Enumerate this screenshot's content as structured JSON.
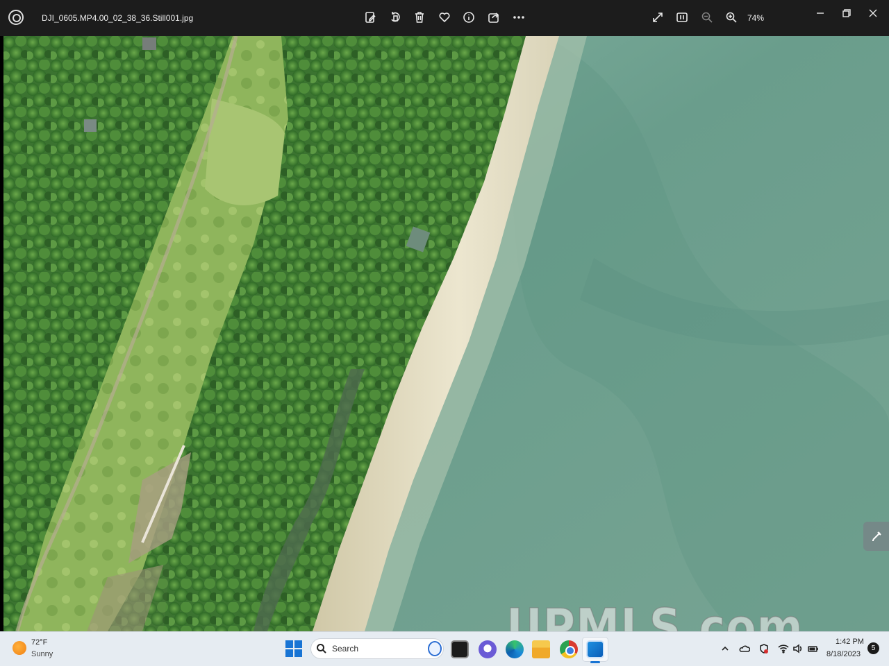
{
  "titlebar": {
    "file_name": "DJI_0605.MP4.00_02_38_36.Still001.jpg",
    "zoom_level": "74%",
    "toolbar_icons": [
      "edit-image-icon",
      "rotate-icon",
      "delete-icon",
      "favorite-icon",
      "info-icon",
      "share-icon",
      "more-icon"
    ],
    "view_icons": [
      "fullscreen-icon",
      "fit-window-icon",
      "zoom-out-icon",
      "zoom-in-icon"
    ],
    "window_controls": [
      "minimize-icon",
      "restore-icon",
      "close-icon"
    ]
  },
  "photo": {
    "description_label": "",
    "watermark": "UPMLS.com"
  },
  "taskbar": {
    "weather": {
      "temperature": "72°F",
      "condition": "Sunny"
    },
    "search_label": "Search",
    "apps": [
      "start-icon",
      "terminal-icon",
      "chat-icon",
      "edge-icon",
      "file-explorer-icon",
      "chrome-icon",
      "photos-icon"
    ],
    "tray_icons": [
      "show-hidden-icon",
      "onedrive-icon",
      "security-icon",
      "wifi-icon",
      "volume-icon",
      "battery-icon"
    ],
    "clock": {
      "time": "1:42 PM",
      "date": "8/18/2023"
    },
    "notification_count": "5"
  },
  "colors": {
    "titlebar_bg": "#1c1c1c",
    "taskbar_bg": "#e6ecf2",
    "accent": "#1874d4",
    "water": "#6fa08e",
    "forest": "#3f7a32",
    "sand": "#ddd6bd"
  }
}
